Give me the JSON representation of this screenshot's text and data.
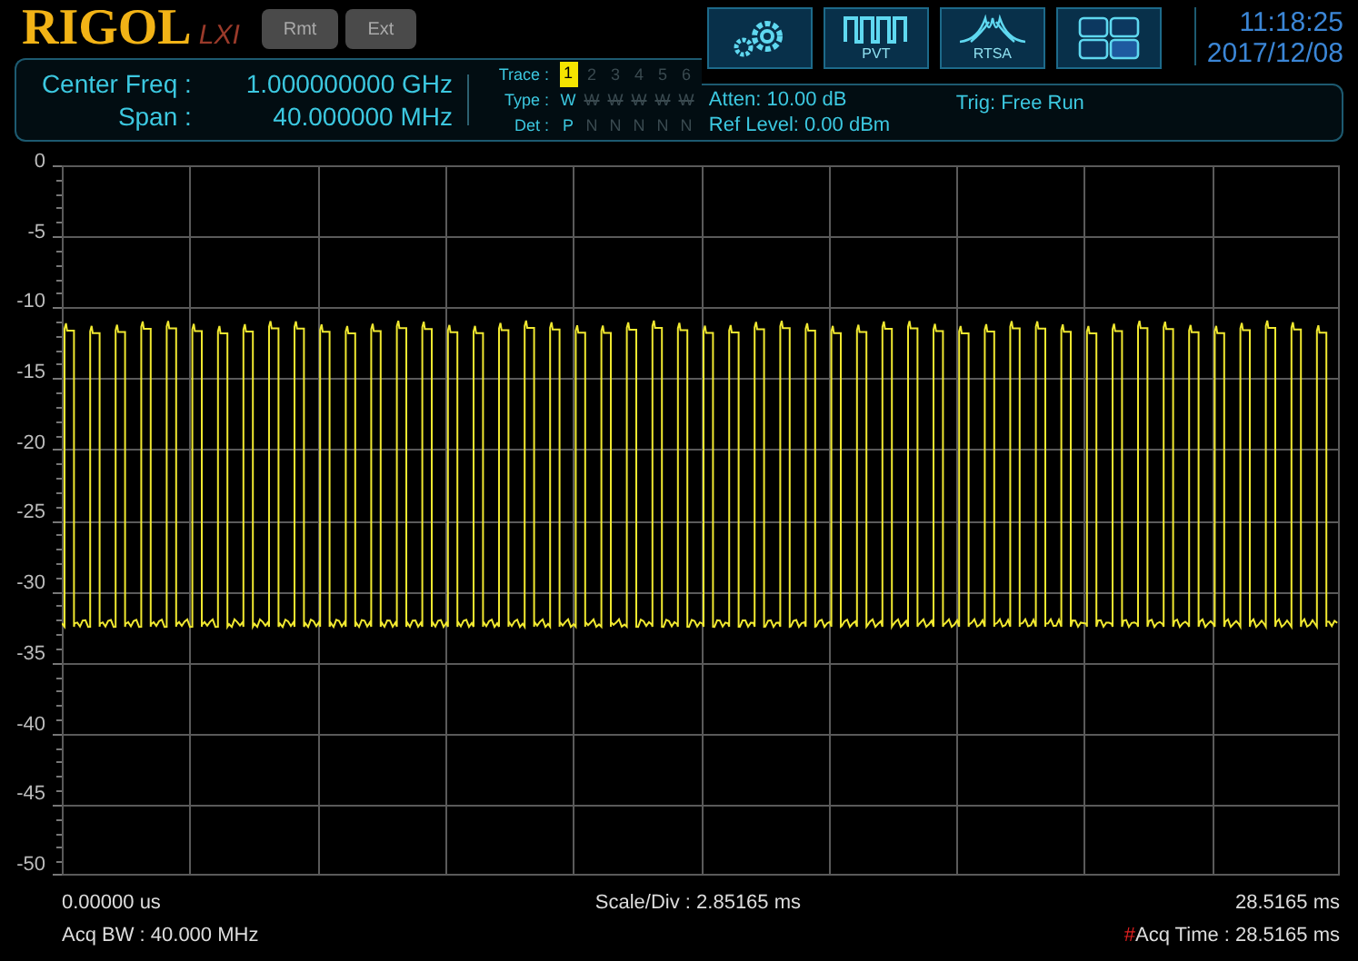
{
  "header": {
    "logo": "RIGOL",
    "lxi": "LXI",
    "buttons": [
      {
        "label": "Rmt"
      },
      {
        "label": "Ext"
      }
    ]
  },
  "readout": [
    {
      "label": "Center Freq :",
      "value": "1.000000000 GHz"
    },
    {
      "label": "Span :",
      "value": "40.000000 MHz"
    }
  ],
  "trace_table": {
    "trace_label": "Trace :",
    "type_label": "Type :",
    "det_label": "Det :",
    "traces": [
      {
        "number": "1",
        "type": "W",
        "det": "P",
        "selected": true
      },
      {
        "number": "2",
        "type": "W",
        "det": "N",
        "selected": false
      },
      {
        "number": "3",
        "type": "W",
        "det": "N",
        "selected": false
      },
      {
        "number": "4",
        "type": "W",
        "det": "N",
        "selected": false
      },
      {
        "number": "5",
        "type": "W",
        "det": "N",
        "selected": false
      },
      {
        "number": "6",
        "type": "W",
        "det": "N",
        "selected": false
      }
    ]
  },
  "toolbar": [
    {
      "kind": "settings"
    },
    {
      "kind": "pvt",
      "label": "PVT"
    },
    {
      "kind": "rtsa",
      "label": "RTSA"
    },
    {
      "kind": "layout"
    }
  ],
  "clock": {
    "time": "11:18:25",
    "date": "2017/12/08"
  },
  "info": {
    "atten": "Atten: 10.00 dB",
    "ref_level": "Ref Level: 0.00 dBm",
    "trig": "Trig: Free Run"
  },
  "plot": {
    "y_labels": [
      "0",
      "-5",
      "-10",
      "-15",
      "-20",
      "-25",
      "-30",
      "-35",
      "-40",
      "-45",
      "-50"
    ]
  },
  "footer": {
    "x_start": "0.00000 us",
    "scale": "Scale/Div : 2.85165 ms",
    "x_end": "28.5165 ms",
    "acq_bw": "Acq BW : 40.000 MHz",
    "acq_time_mark": "#",
    "acq_time": "Acq Time : 28.5165 ms"
  }
}
